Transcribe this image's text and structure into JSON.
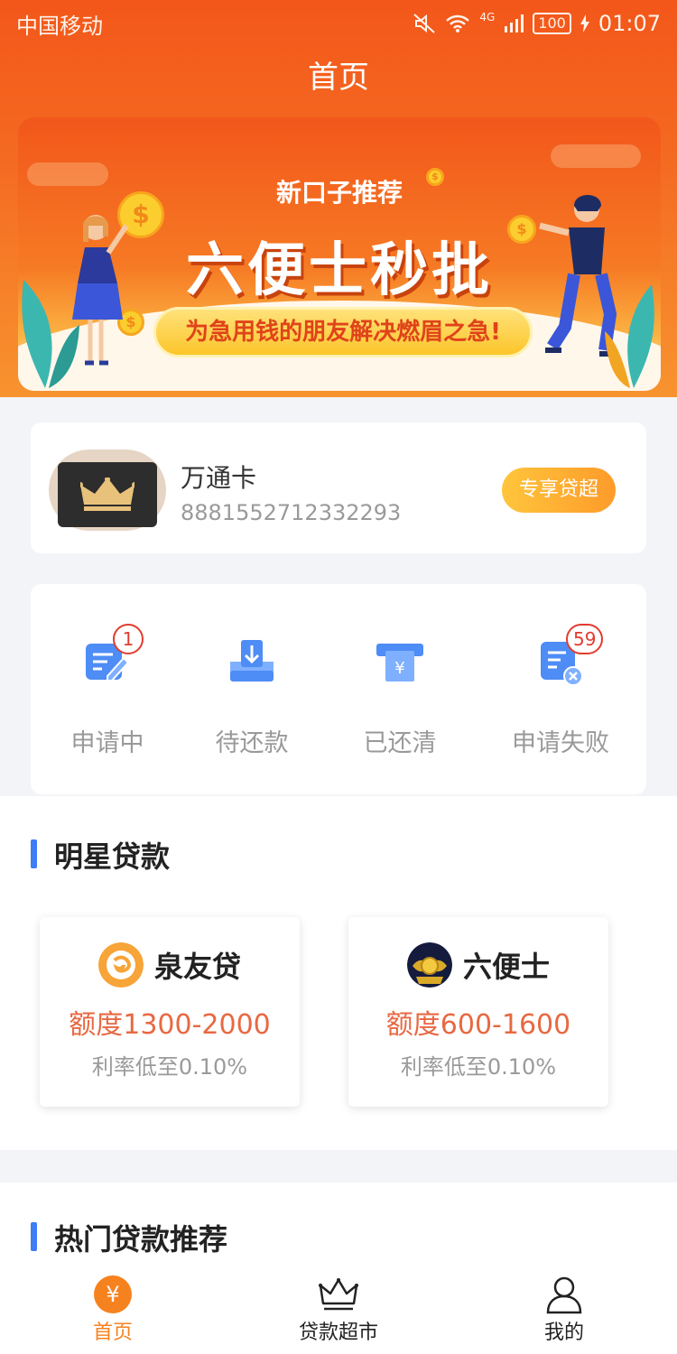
{
  "status_bar": {
    "carrier": "中国移动",
    "network": "4G",
    "battery": "100",
    "time": "01:07"
  },
  "header": {
    "title": "首页"
  },
  "banner": {
    "subtitle": "新口子推荐",
    "headline": "六便士秒批",
    "slogan": "为急用钱的朋友解决燃眉之急!"
  },
  "vip_card": {
    "name": "万通卡",
    "number": "8881552712332293",
    "button": "专享贷超"
  },
  "order_status": [
    {
      "label": "申请中",
      "badge": "1",
      "icon": "apply-icon"
    },
    {
      "label": "待还款",
      "badge": "",
      "icon": "repay-download-icon"
    },
    {
      "label": "已还清",
      "badge": "",
      "icon": "paid-off-icon"
    },
    {
      "label": "申请失败",
      "badge": "59",
      "icon": "apply-failed-icon"
    }
  ],
  "star_loans": {
    "title": "明星贷款",
    "items": [
      {
        "name": "泉友贷",
        "amount": "额度1300-2000",
        "rate": "利率低至0.10%"
      },
      {
        "name": "六便士",
        "amount": "额度600-1600",
        "rate": "利率低至0.10%"
      }
    ]
  },
  "hot_loans": {
    "title": "热门贷款推荐"
  },
  "tabbar": [
    {
      "label": "首页",
      "active": true
    },
    {
      "label": "贷款超市",
      "active": false
    },
    {
      "label": "我的",
      "active": false
    }
  ],
  "colors": {
    "accent": "#f6821f",
    "header": "#f3571a",
    "amount": "#e86842",
    "section_bar": "#3d7df5",
    "badge": "#e23c2e"
  }
}
